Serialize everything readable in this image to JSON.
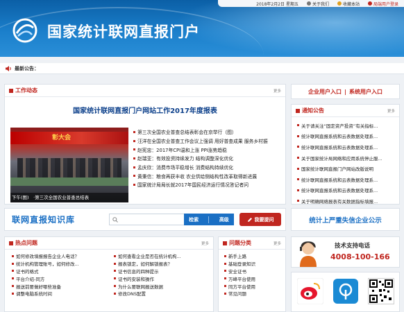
{
  "header": {
    "date": "2018年2月2日 星期五",
    "about": "关于我们",
    "favorite": "收藏本站",
    "login": "局端用户登录",
    "title": "国家统计联网直报门户"
  },
  "notice": {
    "label": "最新公告："
  },
  "work": {
    "title": "工作动态",
    "more": "更多",
    "headline": "国家统计联网直报门户网站工作2017年度报表",
    "photo_banner": "彰大会",
    "photo_caption": "下午(图)　·第三次全国农业普查总结表",
    "items": [
      "第三次全国农业普查总结表彰会在京举行（图）",
      "汪洋在全国农业普查工作会议上强调 用好普查成果 服务乡村振",
      "赵宪忠：2017年CPI温和上涨 PPI涨势趋稳",
      "赵瑞亚：有效投资持续发力 结构调整深化优化",
      "孟庆欣：消费市场平稳增长 消费结构持续优化",
      "黄秉信：粮食再获丰收 农业供给侧结构性改革取得新进展",
      "国家统计局局长就2017年国民经济运行情况答记者问"
    ]
  },
  "entrance": {
    "enterprise": "企业用户入口",
    "system": "系统用户入口",
    "sep": "|"
  },
  "notices": {
    "title": "通知公告",
    "more": "更多",
    "items": [
      "关于请关注“固定资产投资”有关指标...",
      "统计联网直报系统和云表数据处理系...",
      "统计联网直报系统和云表数据处理系...",
      "关于国家统计局网络和应用系统停止服...",
      "国家统计联网直报门户网站改版说明",
      "统计联网直报系统和云表数据处理系...",
      "统计联网直报系统和云表数据处理系...",
      "关于明确网络报表有关数据指标填报..."
    ]
  },
  "knowledge": {
    "title": "联网直报知识库",
    "search_btn": "检索",
    "advanced_btn": "高级",
    "ask_btn": "我要提问"
  },
  "blacklist": {
    "label": "统计上严重失信企业公示"
  },
  "hot": {
    "title": "热点问题",
    "more": "更多",
    "left": [
      "如何修改填报报告企业人电话？",
      "统计机构管理账号，如何修改...",
      "证书的格式",
      "平台介绍-同方",
      "报送前要做好哪些准备",
      "调整电脑系统时间"
    ],
    "right": [
      "如何查看企业是否在统计机构...",
      "报表锁定，如何解锁报表？",
      "证书信息的四种提示",
      "证书的安装和操作",
      "为什么要联网报送数据",
      "修改DNS配置"
    ]
  },
  "cats": {
    "title": "问题分类",
    "more": "更多",
    "items": [
      "新手上路",
      "基础登录知识",
      "安全证书",
      "万峰平台使用",
      "同方平台使用",
      "常见问题"
    ]
  },
  "support": {
    "label": "技术支持电话",
    "phone": "4008-100-166"
  },
  "colors": {
    "brand_red": "#c0261f",
    "brand_blue": "#1a6fc4",
    "header_blue": "#0b5fa6"
  }
}
